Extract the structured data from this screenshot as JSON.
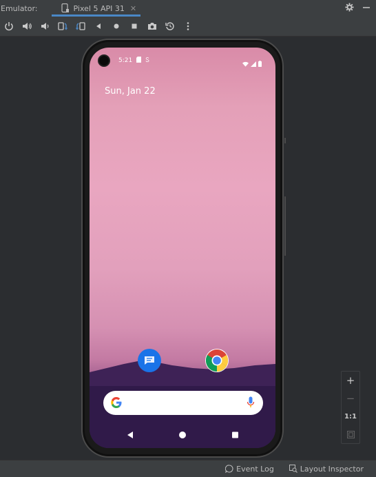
{
  "window": {
    "title": "Emulator:",
    "tab_label": "Pixel 5 API 31",
    "tab_close": "✕"
  },
  "toolbar": {
    "buttons": [
      "power-icon",
      "volume-up-icon",
      "volume-down-icon",
      "rotate-left-icon",
      "rotate-right-icon",
      "back-icon",
      "home-icon",
      "overview-icon",
      "screenshot-icon",
      "snapshot-icon",
      "more-icon"
    ]
  },
  "phone": {
    "status_time": "5:21",
    "date": "Sun, Jan 22",
    "apps": [
      "messages-icon",
      "chrome-icon"
    ],
    "search_placeholder": ""
  },
  "zoom": {
    "zoom_in": "+",
    "zoom_out": "−",
    "one_to_one": "1:1"
  },
  "statusline": {
    "event_log": "Event Log",
    "layout_inspector": "Layout Inspector"
  },
  "colors": {
    "accent": "#4a88c7",
    "panel": "#3c3f41",
    "background": "#2b2d30"
  }
}
